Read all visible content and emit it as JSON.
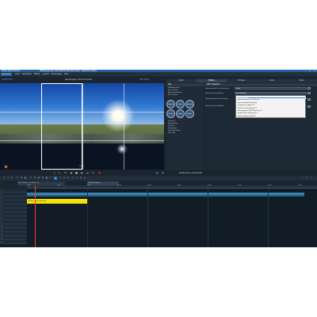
{
  "app": {
    "title": "MAGIX Movie Edit Pro",
    "window_title": "360Degreevideo.mep (MAGIX 360 Grad Video) - [360 Grad Video]"
  },
  "menubar": {
    "logo": "MOVIE EDIT",
    "items": [
      "Datei",
      "Bearbeiten",
      "Effekte",
      "Ansicht",
      "Wiedergabe",
      "Hilfe"
    ]
  },
  "preview": {
    "mode": "MOVIE EDIT",
    "label": "Wiedergabe: 360 Grad Video",
    "right_label": "360 GRAD",
    "bottom_tc": "00:00"
  },
  "right_tabs": [
    "Import",
    "Effekte",
    "Vorlagen",
    "Audio",
    "Store"
  ],
  "active_tab": "Effekte",
  "effects_tree": {
    "header": "360",
    "items": [
      "Vollbildansicht",
      "Übersichtlich",
      "Ansichtsdefinition",
      "360° Effekte",
      "Video-FX",
      "Audioeffekte",
      "Titelstile",
      "Übergänge",
      "360 Grad Video",
      "360° Bild"
    ]
  },
  "fx_icons": [
    "Horizont",
    "Punkt",
    "Projektion",
    "Drehen",
    "Neigen",
    "Rollen"
  ],
  "properties": {
    "title": "360° Projektion",
    "rows": [
      {
        "label": "Kameramodell für die Projektion",
        "value": "Kugel"
      },
      {
        "label": "Kamera-Stitching-Modus",
        "value": "Kein Stitching"
      },
      {
        "label": "Kameramodell für die Vorlanse",
        "value": ""
      },
      {
        "label": "Kamera-Stitching-Modell",
        "value": ""
      }
    ],
    "dropdown_options": [
      "Kein Stitching",
      "Panorama-Ansicht im Vorlanse",
      "Equirectangular (Stitching)",
      "Projektion auf Kugel 4:3",
      "Ricoh Theta (Stitching) 2:1",
      "Samsung Gear 360 (Stitching) 2:1",
      "Kodak PixPro (Stitching) 2:1",
      "Nikon KeyMission 360 2:1"
    ],
    "selected_option": 0
  },
  "transport": {
    "timecode": "00:00:00:00   |   00:00:00:00"
  },
  "timeline": {
    "tabs": [
      "Alle Schnitte im Video-Clip",
      "360 Grad Video"
    ],
    "ruler": [
      "00:00",
      "00:10",
      "00:20",
      "00:30",
      "00:40",
      "00:50",
      "01:00",
      "01:10",
      "01:20",
      "01:30"
    ],
    "tracks": [
      "1",
      "2",
      "3",
      "4",
      "5",
      "6",
      "7",
      "8",
      "9",
      "10",
      "11",
      "12",
      "13",
      "14"
    ],
    "yellow_clip_label": "360Degreevideo.mp4  Audio"
  },
  "colors": {
    "titlebar": "#1e5fa3",
    "accent": "#4aa3e8",
    "selected": "#1e73c8",
    "clip_yellow": "#f5e10a",
    "clip_blue": "#3e7fb8",
    "playhead": "#ff3b30",
    "record": "#e8342a"
  }
}
